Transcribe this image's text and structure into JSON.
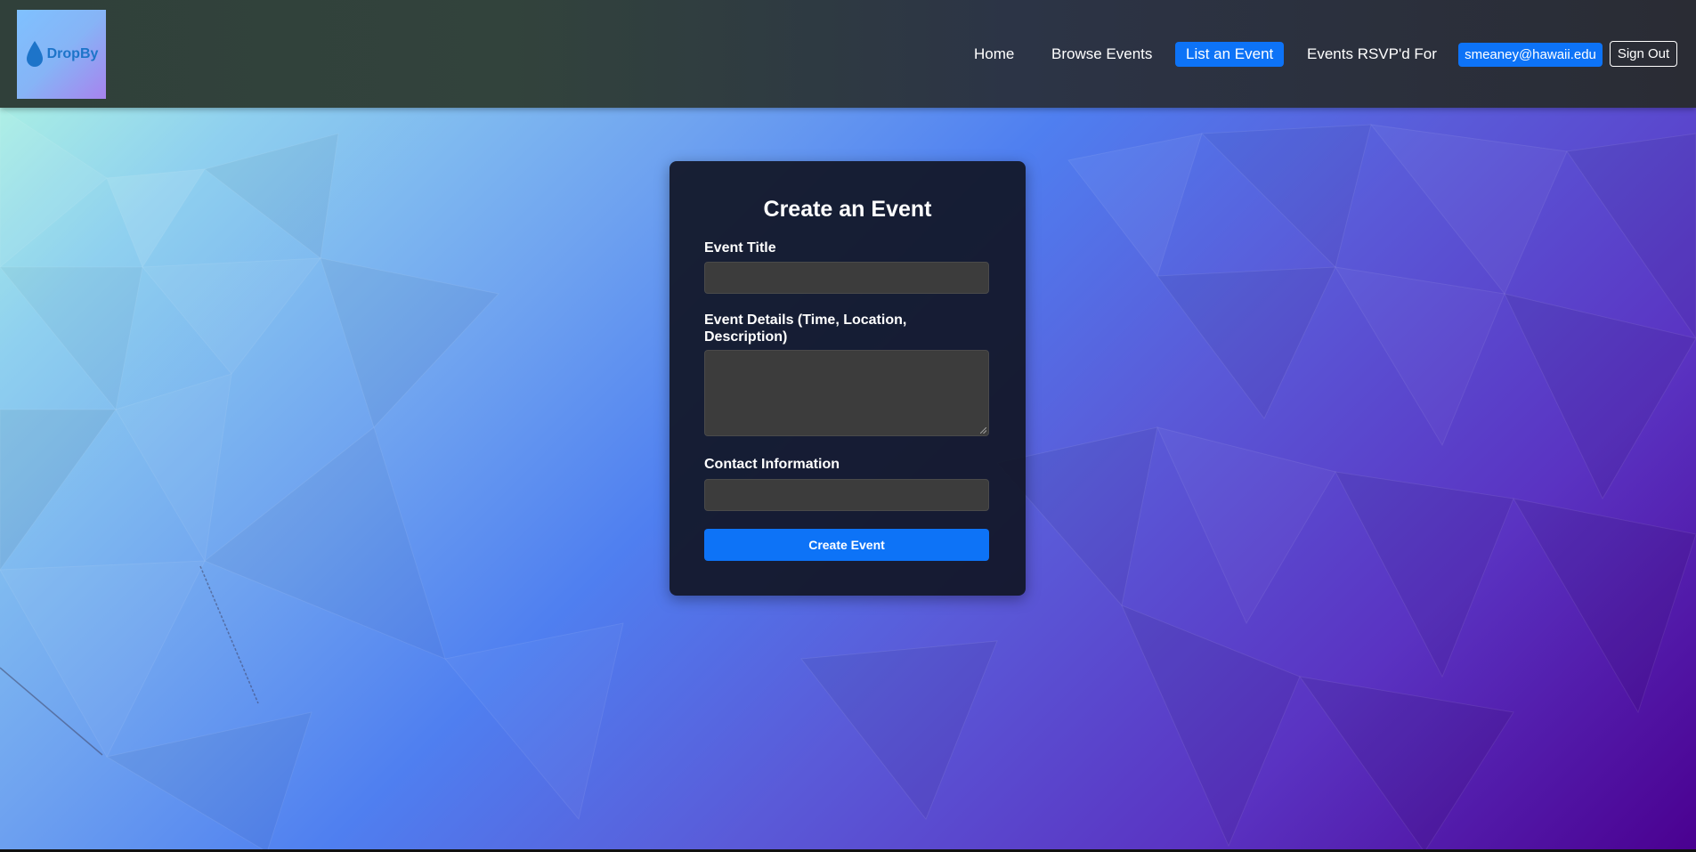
{
  "brand": {
    "logo_text": "DropBy",
    "logo_icon": "water-drop-icon",
    "accent": "#0d73f7"
  },
  "nav": {
    "items": [
      {
        "label": "Home",
        "active": false
      },
      {
        "label": "Browse Events",
        "active": false
      },
      {
        "label": "List an Event",
        "active": true
      },
      {
        "label": "Events RSVP'd For",
        "active": false
      }
    ],
    "user_email": "smeaney@hawaii.edu",
    "sign_out_label": "Sign Out"
  },
  "form": {
    "title": "Create an Event",
    "event_title_label": "Event Title",
    "event_title_value": "",
    "event_details_label": "Event Details (Time, Location, Description)",
    "event_details_value": "",
    "contact_label": "Contact Information",
    "contact_value": "",
    "submit_label": "Create Event"
  }
}
